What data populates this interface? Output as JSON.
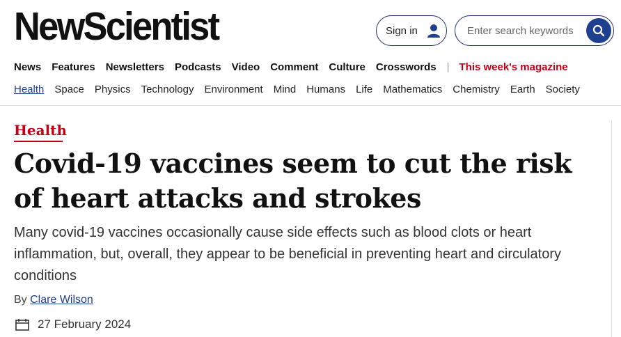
{
  "header": {
    "logo_text": "NewScientist",
    "signin_label": "Sign in",
    "search_placeholder": "Enter search keywords"
  },
  "nav_primary": {
    "items": [
      "News",
      "Features",
      "Newsletters",
      "Podcasts",
      "Video",
      "Comment",
      "Culture",
      "Crosswords"
    ],
    "separator": "|",
    "magazine_label": "This week's magazine"
  },
  "nav_secondary": {
    "items": [
      "Health",
      "Space",
      "Physics",
      "Technology",
      "Environment",
      "Mind",
      "Humans",
      "Life",
      "Mathematics",
      "Chemistry",
      "Earth",
      "Society"
    ],
    "active": "Health"
  },
  "article": {
    "section": "Health",
    "headline": "Covid-19 vaccines seem to cut the risk of heart attacks and strokes",
    "standfirst": "Many covid-19 vaccines occasionally cause side effects such as blood clots or heart inflammation, but, overall, they appear to be beneficial in preventing heart and circulatory conditions",
    "byline_prefix": "By",
    "author": "Clare Wilson",
    "date": "27 February 2024"
  },
  "colors": {
    "brand_red": "#c00017",
    "navy": "#1f3f8f"
  },
  "icons": {
    "user": "user-icon",
    "search": "search-icon",
    "calendar": "calendar-icon"
  }
}
